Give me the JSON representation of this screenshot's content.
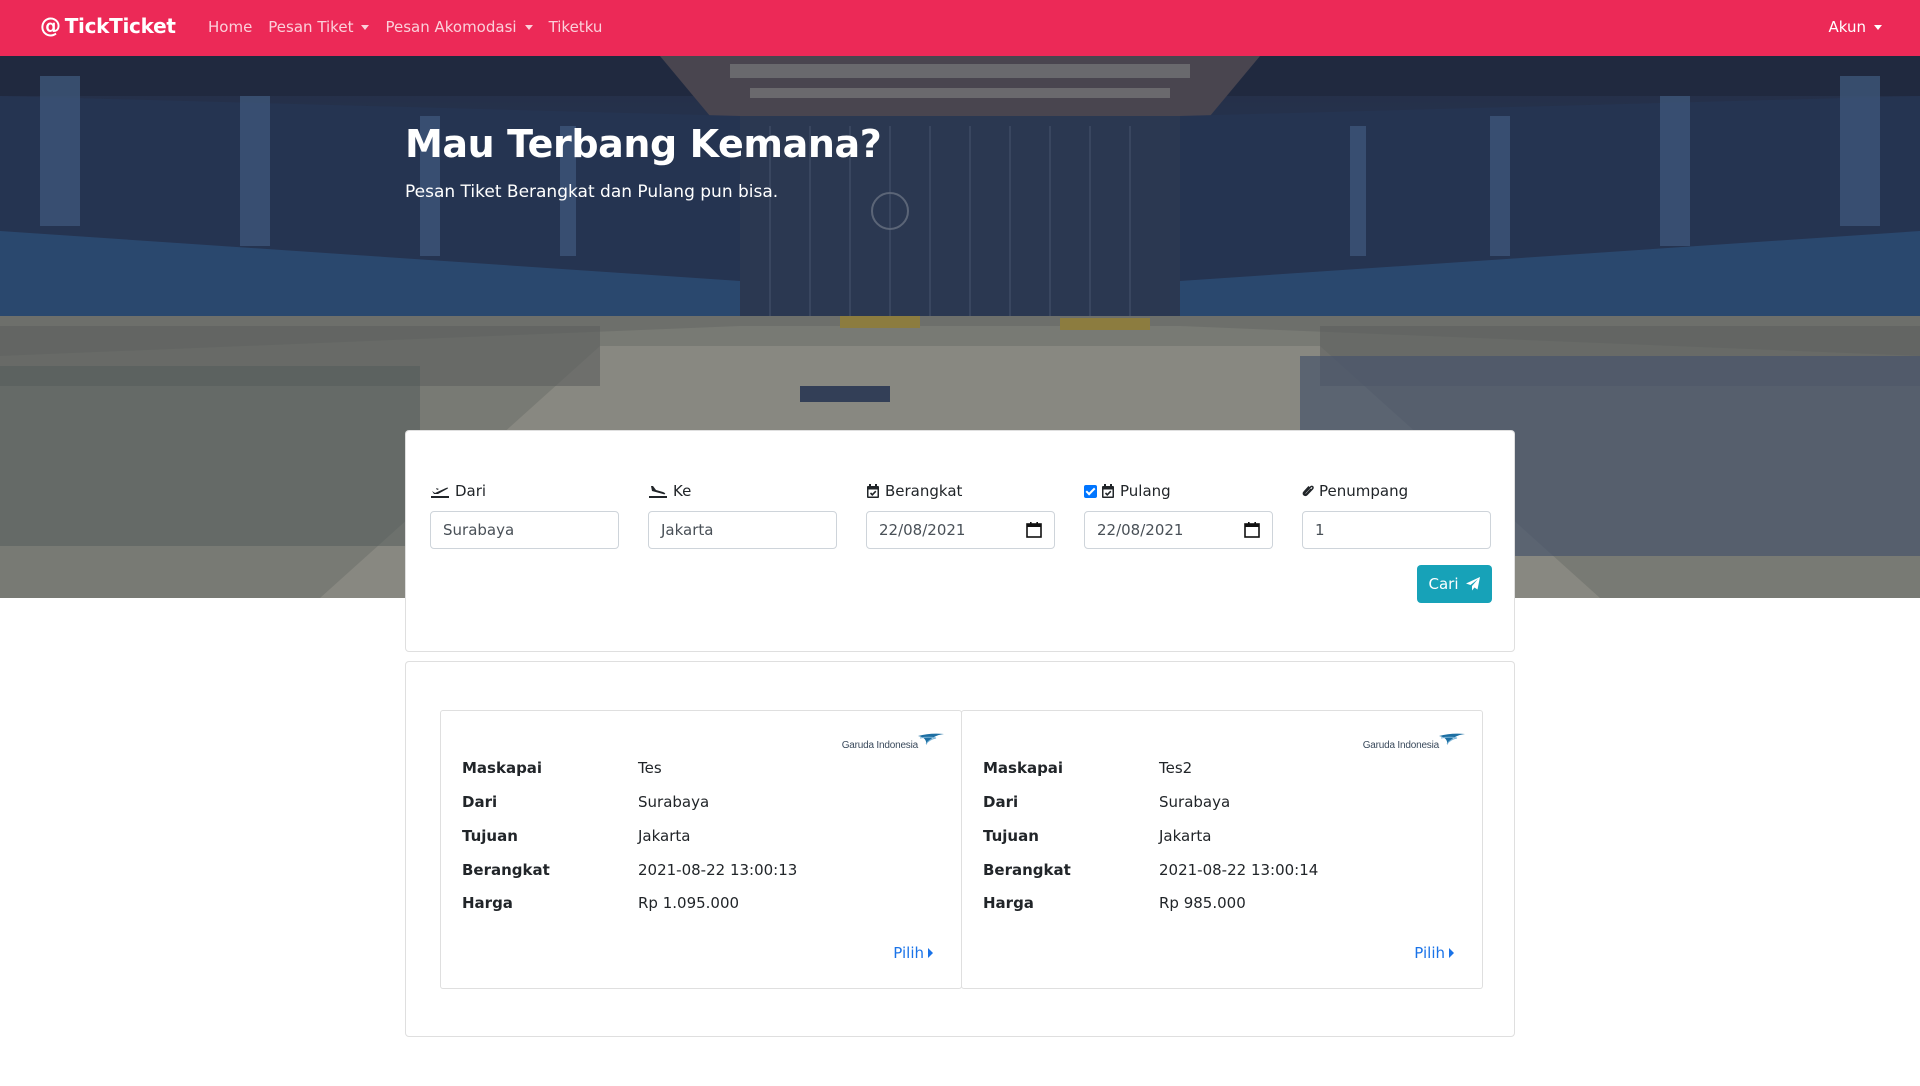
{
  "navbar": {
    "brand": "TickTicket",
    "links": [
      "Home",
      "Pesan Tiket",
      "Pesan Akomodasi",
      "Tiketku"
    ],
    "account": "Akun",
    "color": "#ec2957"
  },
  "hero": {
    "title": "Mau Terbang Kemana?",
    "subtitle": "Pesan Tiket Berangkat dan Pulang pun bisa."
  },
  "search": {
    "from_label": "Dari",
    "from_value": "Surabaya",
    "to_label": "Ke",
    "to_value": "Jakarta",
    "depart_label": "Berangkat",
    "depart_value": "22/08/2021",
    "return_label": "Pulang",
    "return_value": "22/08/2021",
    "return_checked": true,
    "passenger_label": "Penumpang",
    "passenger_value": "1",
    "search_button": "Cari",
    "button_color": "#17a2b8"
  },
  "results": [
    {
      "airline_logo_text": "Garuda Indonesia",
      "fields": [
        {
          "label": "Maskapai",
          "value": "Tes"
        },
        {
          "label": "Dari",
          "value": "Surabaya"
        },
        {
          "label": "Tujuan",
          "value": "Jakarta"
        },
        {
          "label": "Berangkat",
          "value": "2021-08-22 13:00:13"
        },
        {
          "label": "Harga",
          "value": "Rp 1.095.000"
        }
      ],
      "select_label": "Pilih"
    },
    {
      "airline_logo_text": "Garuda Indonesia",
      "fields": [
        {
          "label": "Maskapai",
          "value": "Tes2"
        },
        {
          "label": "Dari",
          "value": "Surabaya"
        },
        {
          "label": "Tujuan",
          "value": "Jakarta"
        },
        {
          "label": "Berangkat",
          "value": "2021-08-22 13:00:14"
        },
        {
          "label": "Harga",
          "value": "Rp 985.000"
        }
      ],
      "select_label": "Pilih"
    }
  ]
}
